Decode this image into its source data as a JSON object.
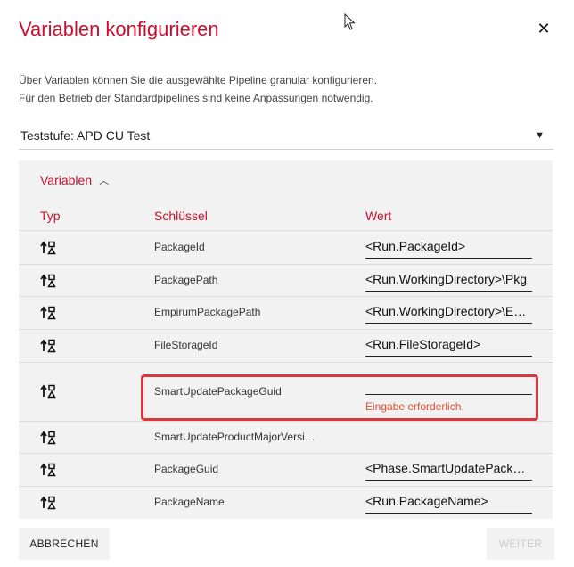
{
  "dialog": {
    "title": "Variablen konfigurieren",
    "description_line1": "Über Variablen können Sie die ausgewählte Pipeline granular konfigurieren.",
    "description_line2": "Für den Betrieb der Standardpipelines sind keine Anpassungen notwendig."
  },
  "stage_select": {
    "value": "Teststufe: APD CU Test"
  },
  "variables": {
    "section_label": "Variablen",
    "columns": {
      "type": "Typ",
      "key": "Schlüssel",
      "value": "Wert"
    },
    "rows": [
      {
        "key": "PackageId",
        "value": "<Run.PackageId>"
      },
      {
        "key": "PackagePath",
        "value": "<Run.WorkingDirectory>\\Pkg"
      },
      {
        "key": "EmpirumPackagePath",
        "value": "<Run.WorkingDirectory>\\E…"
      },
      {
        "key": "FileStorageId",
        "value": "<Run.FileStorageId>"
      },
      {
        "key": "SmartUpdatePackageGuid",
        "value": "",
        "error": "Eingabe erforderlich."
      },
      {
        "key": "SmartUpdateProductMajorVersi…",
        "value": ""
      },
      {
        "key": "PackageGuid",
        "value": "<Phase.SmartUpdatePacka…"
      },
      {
        "key": "PackageName",
        "value": "<Run.PackageName>"
      }
    ]
  },
  "footer": {
    "cancel_label": "ABBRECHEN",
    "next_label": "WEITER"
  },
  "colors": {
    "accent": "#c8102e",
    "error": "#d9363e",
    "panel": "#f2f2f2"
  }
}
